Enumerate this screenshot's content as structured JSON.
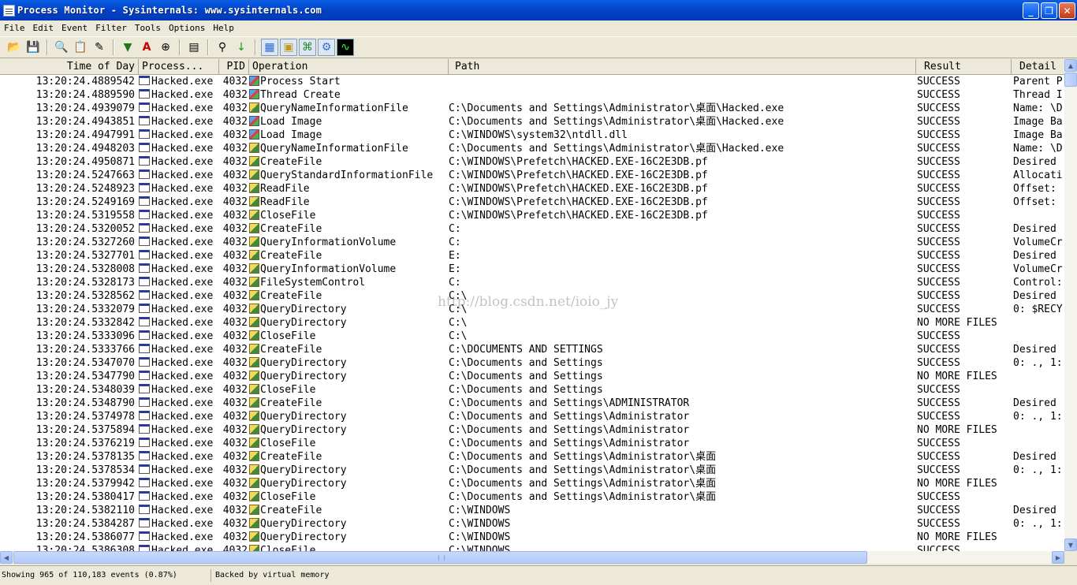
{
  "window": {
    "title": "Process Monitor - Sysinternals: www.sysinternals.com",
    "buttons": {
      "minimize": "_",
      "maximize": "❐",
      "close": "✕"
    }
  },
  "menu": [
    "File",
    "Edit",
    "Event",
    "Filter",
    "Tools",
    "Options",
    "Help"
  ],
  "toolbar": [
    "open-icon",
    "save-icon",
    "magnify-icon",
    "autoscroll-icon",
    "clear-icon",
    "filter-icon",
    "highlight-icon",
    "target-icon",
    "jump-icon",
    "find-icon",
    "next-icon",
    "registry-icon",
    "filesystem-icon",
    "network-icon",
    "process-thread-icon",
    "profiling-icon"
  ],
  "columns": {
    "time": "Time of Day",
    "process": "Process...",
    "pid": "PID",
    "operation": "Operation",
    "path": "Path",
    "result": "Result",
    "detail": "Detail"
  },
  "rows": [
    {
      "time": "13:20:24.4889542",
      "process": "Hacked.exe",
      "pid": "4032",
      "op": "Process Start",
      "optype": "proc",
      "path": "",
      "result": "SUCCESS",
      "detail": "Parent P"
    },
    {
      "time": "13:20:24.4889590",
      "process": "Hacked.exe",
      "pid": "4032",
      "op": "Thread Create",
      "optype": "proc",
      "path": "",
      "result": "SUCCESS",
      "detail": "Thread I"
    },
    {
      "time": "13:20:24.4939079",
      "process": "Hacked.exe",
      "pid": "4032",
      "op": "QueryNameInformationFile",
      "optype": "file",
      "path": "C:\\Documents and Settings\\Administrator\\桌面\\Hacked.exe",
      "result": "SUCCESS",
      "detail": "Name: \\D"
    },
    {
      "time": "13:20:24.4943851",
      "process": "Hacked.exe",
      "pid": "4032",
      "op": "Load Image",
      "optype": "proc",
      "path": "C:\\Documents and Settings\\Administrator\\桌面\\Hacked.exe",
      "result": "SUCCESS",
      "detail": "Image Ba"
    },
    {
      "time": "13:20:24.4947991",
      "process": "Hacked.exe",
      "pid": "4032",
      "op": "Load Image",
      "optype": "proc",
      "path": "C:\\WINDOWS\\system32\\ntdll.dll",
      "result": "SUCCESS",
      "detail": "Image Ba"
    },
    {
      "time": "13:20:24.4948203",
      "process": "Hacked.exe",
      "pid": "4032",
      "op": "QueryNameInformationFile",
      "optype": "file",
      "path": "C:\\Documents and Settings\\Administrator\\桌面\\Hacked.exe",
      "result": "SUCCESS",
      "detail": "Name: \\D"
    },
    {
      "time": "13:20:24.4950871",
      "process": "Hacked.exe",
      "pid": "4032",
      "op": "CreateFile",
      "optype": "file",
      "path": "C:\\WINDOWS\\Prefetch\\HACKED.EXE-16C2E3DB.pf",
      "result": "SUCCESS",
      "detail": "Desired"
    },
    {
      "time": "13:20:24.5247663",
      "process": "Hacked.exe",
      "pid": "4032",
      "op": "QueryStandardInformationFile",
      "optype": "file",
      "path": "C:\\WINDOWS\\Prefetch\\HACKED.EXE-16C2E3DB.pf",
      "result": "SUCCESS",
      "detail": "Allocati"
    },
    {
      "time": "13:20:24.5248923",
      "process": "Hacked.exe",
      "pid": "4032",
      "op": "ReadFile",
      "optype": "file",
      "path": "C:\\WINDOWS\\Prefetch\\HACKED.EXE-16C2E3DB.pf",
      "result": "SUCCESS",
      "detail": "Offset:"
    },
    {
      "time": "13:20:24.5249169",
      "process": "Hacked.exe",
      "pid": "4032",
      "op": "ReadFile",
      "optype": "file",
      "path": "C:\\WINDOWS\\Prefetch\\HACKED.EXE-16C2E3DB.pf",
      "result": "SUCCESS",
      "detail": "Offset:"
    },
    {
      "time": "13:20:24.5319558",
      "process": "Hacked.exe",
      "pid": "4032",
      "op": "CloseFile",
      "optype": "file",
      "path": "C:\\WINDOWS\\Prefetch\\HACKED.EXE-16C2E3DB.pf",
      "result": "SUCCESS",
      "detail": ""
    },
    {
      "time": "13:20:24.5320052",
      "process": "Hacked.exe",
      "pid": "4032",
      "op": "CreateFile",
      "optype": "file",
      "path": "C:",
      "result": "SUCCESS",
      "detail": "Desired"
    },
    {
      "time": "13:20:24.5327260",
      "process": "Hacked.exe",
      "pid": "4032",
      "op": "QueryInformationVolume",
      "optype": "file",
      "path": "C:",
      "result": "SUCCESS",
      "detail": "VolumeCr"
    },
    {
      "time": "13:20:24.5327701",
      "process": "Hacked.exe",
      "pid": "4032",
      "op": "CreateFile",
      "optype": "file",
      "path": "E:",
      "result": "SUCCESS",
      "detail": "Desired"
    },
    {
      "time": "13:20:24.5328008",
      "process": "Hacked.exe",
      "pid": "4032",
      "op": "QueryInformationVolume",
      "optype": "file",
      "path": "E:",
      "result": "SUCCESS",
      "detail": "VolumeCr"
    },
    {
      "time": "13:20:24.5328173",
      "process": "Hacked.exe",
      "pid": "4032",
      "op": "FileSystemControl",
      "optype": "file",
      "path": "C:",
      "result": "SUCCESS",
      "detail": "Control:"
    },
    {
      "time": "13:20:24.5328562",
      "process": "Hacked.exe",
      "pid": "4032",
      "op": "CreateFile",
      "optype": "file",
      "path": "C:\\",
      "result": "SUCCESS",
      "detail": "Desired"
    },
    {
      "time": "13:20:24.5332079",
      "process": "Hacked.exe",
      "pid": "4032",
      "op": "QueryDirectory",
      "optype": "file",
      "path": "C:\\",
      "result": "SUCCESS",
      "detail": "0: $RECY"
    },
    {
      "time": "13:20:24.5332842",
      "process": "Hacked.exe",
      "pid": "4032",
      "op": "QueryDirectory",
      "optype": "file",
      "path": "C:\\",
      "result": "NO MORE FILES",
      "detail": ""
    },
    {
      "time": "13:20:24.5333096",
      "process": "Hacked.exe",
      "pid": "4032",
      "op": "CloseFile",
      "optype": "file",
      "path": "C:\\",
      "result": "SUCCESS",
      "detail": ""
    },
    {
      "time": "13:20:24.5333766",
      "process": "Hacked.exe",
      "pid": "4032",
      "op": "CreateFile",
      "optype": "file",
      "path": "C:\\DOCUMENTS AND SETTINGS",
      "result": "SUCCESS",
      "detail": "Desired"
    },
    {
      "time": "13:20:24.5347070",
      "process": "Hacked.exe",
      "pid": "4032",
      "op": "QueryDirectory",
      "optype": "file",
      "path": "C:\\Documents and Settings",
      "result": "SUCCESS",
      "detail": "0: ., 1:"
    },
    {
      "time": "13:20:24.5347790",
      "process": "Hacked.exe",
      "pid": "4032",
      "op": "QueryDirectory",
      "optype": "file",
      "path": "C:\\Documents and Settings",
      "result": "NO MORE FILES",
      "detail": ""
    },
    {
      "time": "13:20:24.5348039",
      "process": "Hacked.exe",
      "pid": "4032",
      "op": "CloseFile",
      "optype": "file",
      "path": "C:\\Documents and Settings",
      "result": "SUCCESS",
      "detail": ""
    },
    {
      "time": "13:20:24.5348790",
      "process": "Hacked.exe",
      "pid": "4032",
      "op": "CreateFile",
      "optype": "file",
      "path": "C:\\Documents and Settings\\ADMINISTRATOR",
      "result": "SUCCESS",
      "detail": "Desired"
    },
    {
      "time": "13:20:24.5374978",
      "process": "Hacked.exe",
      "pid": "4032",
      "op": "QueryDirectory",
      "optype": "file",
      "path": "C:\\Documents and Settings\\Administrator",
      "result": "SUCCESS",
      "detail": "0: ., 1:"
    },
    {
      "time": "13:20:24.5375894",
      "process": "Hacked.exe",
      "pid": "4032",
      "op": "QueryDirectory",
      "optype": "file",
      "path": "C:\\Documents and Settings\\Administrator",
      "result": "NO MORE FILES",
      "detail": ""
    },
    {
      "time": "13:20:24.5376219",
      "process": "Hacked.exe",
      "pid": "4032",
      "op": "CloseFile",
      "optype": "file",
      "path": "C:\\Documents and Settings\\Administrator",
      "result": "SUCCESS",
      "detail": ""
    },
    {
      "time": "13:20:24.5378135",
      "process": "Hacked.exe",
      "pid": "4032",
      "op": "CreateFile",
      "optype": "file",
      "path": "C:\\Documents and Settings\\Administrator\\桌面",
      "result": "SUCCESS",
      "detail": "Desired"
    },
    {
      "time": "13:20:24.5378534",
      "process": "Hacked.exe",
      "pid": "4032",
      "op": "QueryDirectory",
      "optype": "file",
      "path": "C:\\Documents and Settings\\Administrator\\桌面",
      "result": "SUCCESS",
      "detail": "0: ., 1:"
    },
    {
      "time": "13:20:24.5379942",
      "process": "Hacked.exe",
      "pid": "4032",
      "op": "QueryDirectory",
      "optype": "file",
      "path": "C:\\Documents and Settings\\Administrator\\桌面",
      "result": "NO MORE FILES",
      "detail": ""
    },
    {
      "time": "13:20:24.5380417",
      "process": "Hacked.exe",
      "pid": "4032",
      "op": "CloseFile",
      "optype": "file",
      "path": "C:\\Documents and Settings\\Administrator\\桌面",
      "result": "SUCCESS",
      "detail": ""
    },
    {
      "time": "13:20:24.5382110",
      "process": "Hacked.exe",
      "pid": "4032",
      "op": "CreateFile",
      "optype": "file",
      "path": "C:\\WINDOWS",
      "result": "SUCCESS",
      "detail": "Desired"
    },
    {
      "time": "13:20:24.5384287",
      "process": "Hacked.exe",
      "pid": "4032",
      "op": "QueryDirectory",
      "optype": "file",
      "path": "C:\\WINDOWS",
      "result": "SUCCESS",
      "detail": "0: ., 1:"
    },
    {
      "time": "13:20:24.5386077",
      "process": "Hacked.exe",
      "pid": "4032",
      "op": "QueryDirectory",
      "optype": "file",
      "path": "C:\\WINDOWS",
      "result": "NO MORE FILES",
      "detail": ""
    },
    {
      "time": "13:20:24.5386308",
      "process": "Hacked.exe",
      "pid": "4032",
      "op": "CloseFile",
      "optype": "file",
      "path": "C:\\WINDOWS",
      "result": "SUCCESS",
      "detail": ""
    }
  ],
  "status": {
    "events": "Showing 965 of 110,183 events (0.87%)",
    "memory": "Backed by virtual memory"
  },
  "watermark": "http://blog.csdn.net/ioio_jy"
}
